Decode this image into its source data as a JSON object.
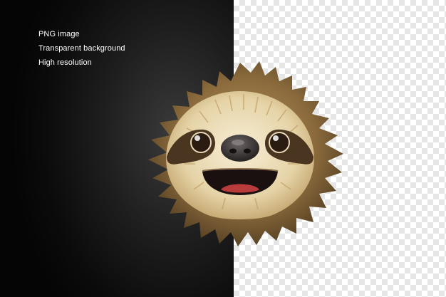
{
  "features": [
    "PNG image",
    "Transparent background",
    "High resolution"
  ],
  "colors": {
    "dark_background": "#0b0b0b",
    "checker_light": "#ffffff",
    "checker_dark": "#e6e6e6",
    "fur_dark": "#5a4526",
    "fur_mid": "#8a6a3c",
    "fur_light": "#efe3c4",
    "eye_mask": "#4a3520",
    "nose": "#2e2a2a",
    "mouth": "#1a1010",
    "tongue": "#b83c3c"
  },
  "illustration": "sloth-head"
}
